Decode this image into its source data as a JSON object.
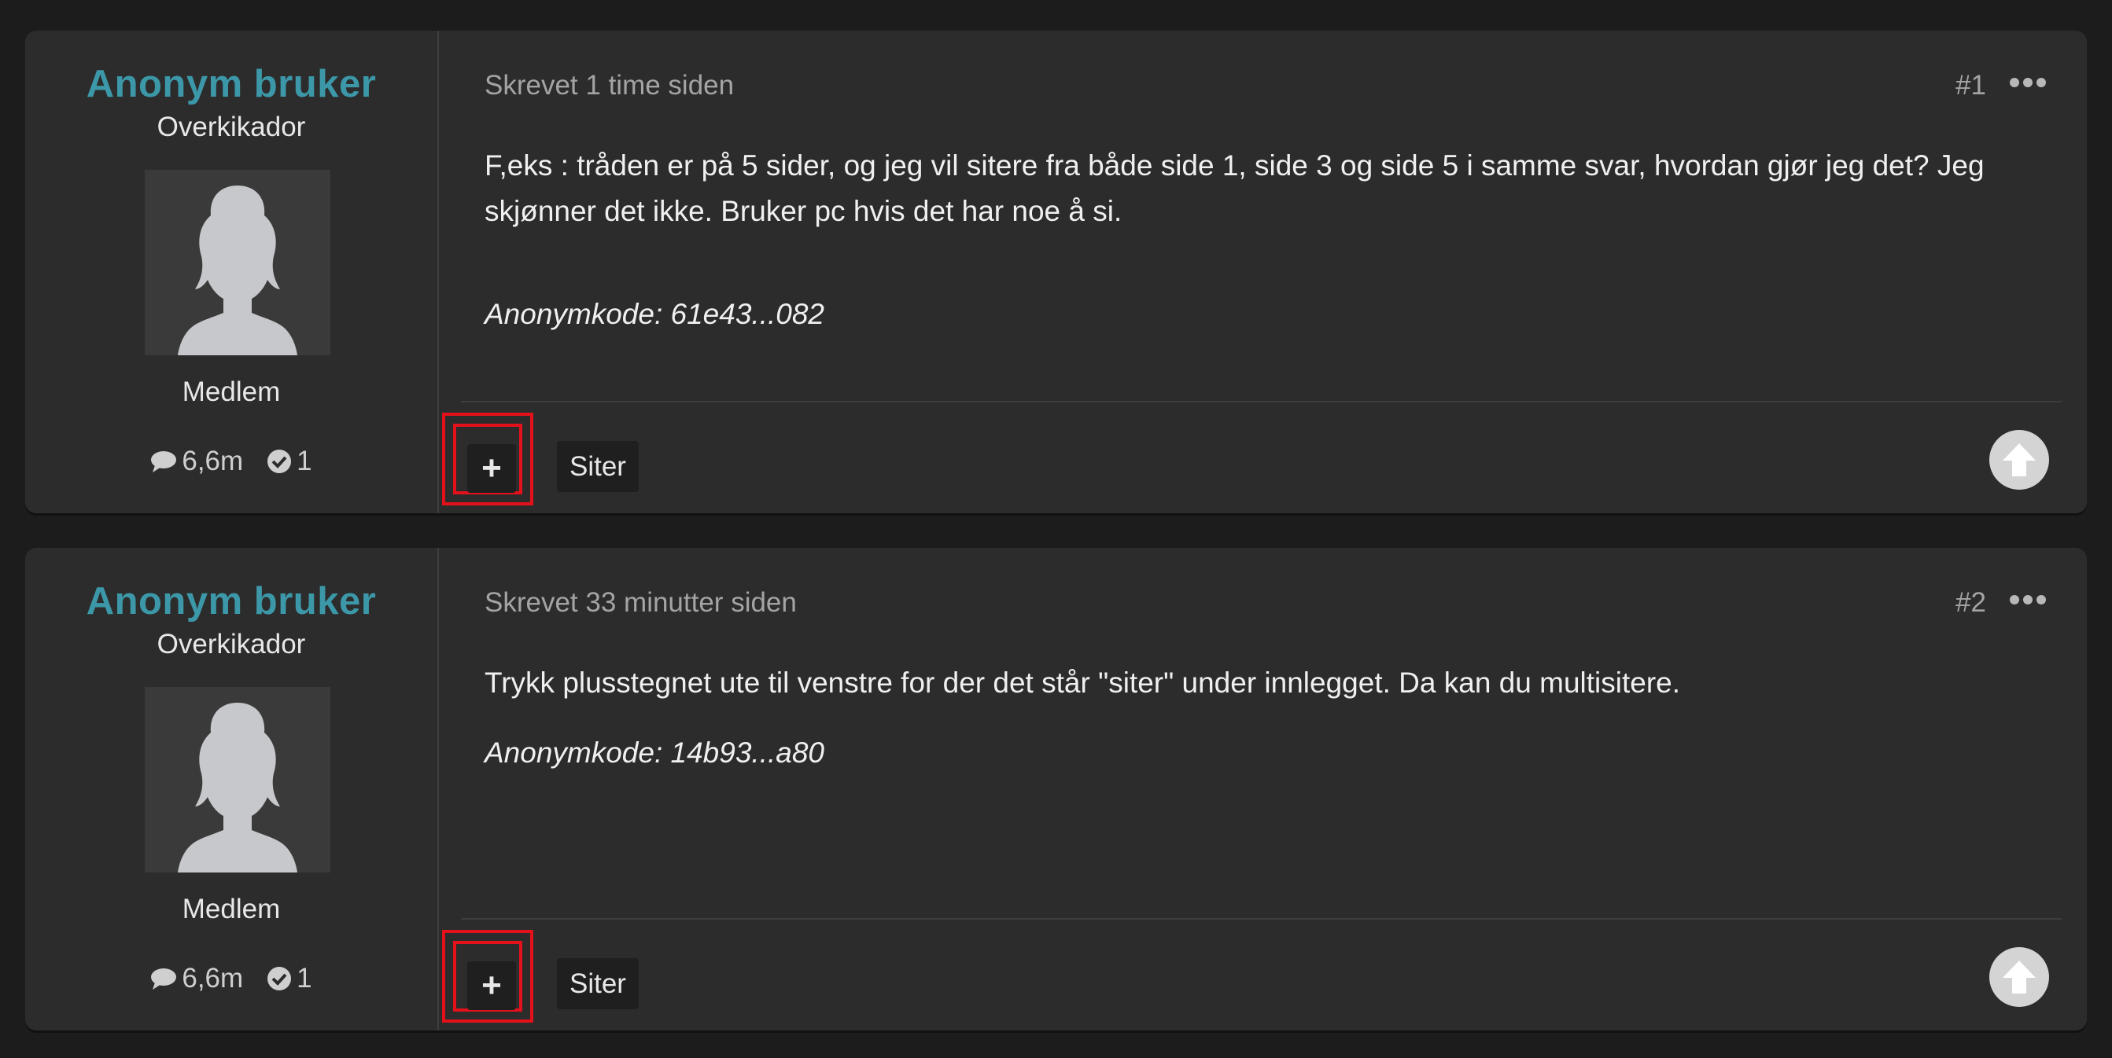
{
  "posts": [
    {
      "author": {
        "name": "Anonym bruker",
        "title": "Overkikador",
        "role": "Medlem",
        "posts_count": "6,6m",
        "reactions_count": "1"
      },
      "posted": "Skrevet 1 time siden",
      "number": "#1",
      "lines": [
        "F,eks : tråden er på 5 sider, og jeg vil sitere fra både side 1, side 3 og side 5 i samme svar, hvordan gjør jeg det? Jeg",
        "skjønner det ikke. Bruker pc hvis det har noe å si."
      ],
      "anon_code": "Anonymkode: 61e43...082",
      "multiquote_label": "+",
      "quote_label": "Siter"
    },
    {
      "author": {
        "name": "Anonym bruker",
        "title": "Overkikador",
        "role": "Medlem",
        "posts_count": "6,6m",
        "reactions_count": "1"
      },
      "posted": "Skrevet 33 minutter siden",
      "number": "#2",
      "lines": [
        "Trykk plusstegnet ute til venstre for der det står \"siter\" under innlegget. Da kan du multisitere."
      ],
      "anon_code": "Anonymkode: 14b93...a80",
      "multiquote_label": "+",
      "quote_label": "Siter"
    }
  ],
  "colors": {
    "accent": "#3c98a8",
    "highlight": "#e4111b",
    "background": "#1c1c1c",
    "card": "#2c2c2c"
  },
  "icons": [
    "comment-icon",
    "check-circle-icon",
    "more-options-icon",
    "arrow-up-icon",
    "plus-icon",
    "avatar-silhouette-icon"
  ]
}
